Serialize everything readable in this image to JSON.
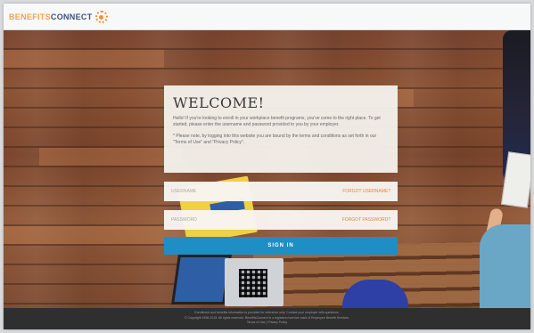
{
  "header": {
    "logo_part1": "BENEFITS",
    "logo_part2": "CONNECT"
  },
  "welcome": {
    "title": "WELCOME!",
    "paragraph1": "Hello! If you're looking to enroll in your workplace benefit programs, you've come to the right place. To get started, please enter the username and password provided to you by your employer.",
    "paragraph2": "* Please note, by logging into this website you are bound by the terms and conditions as set forth in our \"Terms of Use\" and \"Privacy Policy\"."
  },
  "form": {
    "username_placeholder": "USERNAME",
    "forgot_username": "FORGOT USERNAME?",
    "password_placeholder": "PASSWORD",
    "forgot_password": "FORGOT PASSWORD?",
    "signin_label": "SIGN IN"
  },
  "footer": {
    "line1": "Enrollment and benefits information is provided for reference only. Contact your employer with questions.",
    "line2": "© Copyright 1998-2015. All rights reserved. BenefitsConnect is a registered service mark of Employee Benefit Services.",
    "line3": "Terms of Use  |  Privacy Policy"
  },
  "colors": {
    "accent": "#1f8ec4",
    "link": "#e8843a",
    "logo_orange": "#f19133",
    "logo_navy": "#3d4f86"
  }
}
